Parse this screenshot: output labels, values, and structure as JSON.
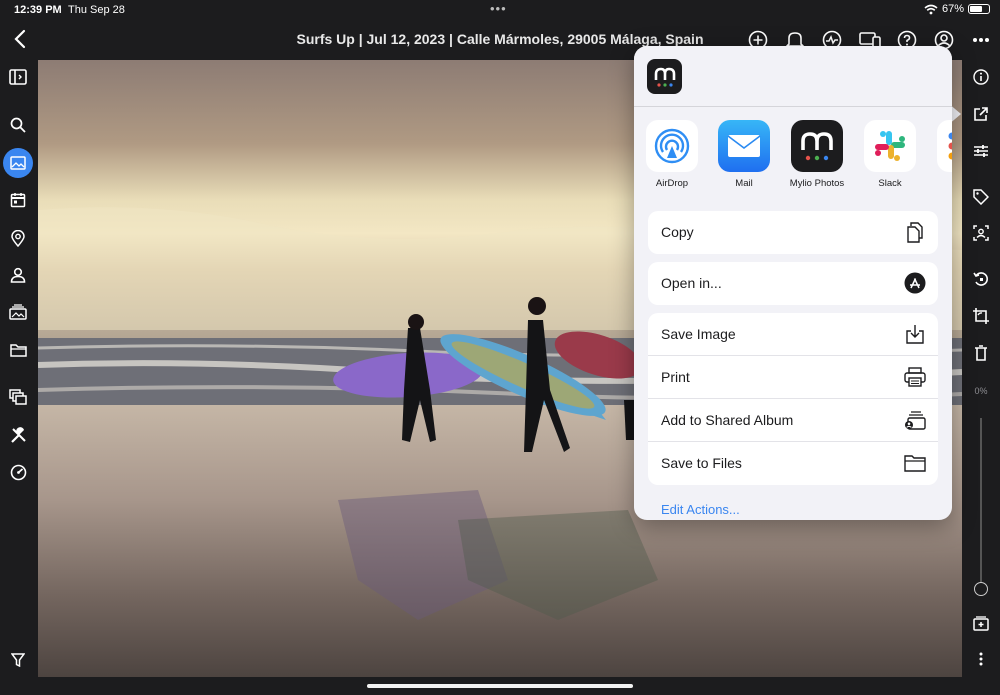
{
  "status_bar": {
    "time": "12:39 PM",
    "date": "Thu Sep 28",
    "center_dots": "•••",
    "battery_percent": "67%",
    "battery_level": 0.67
  },
  "header": {
    "title": "Surfs Up | Jul 12, 2023 | Calle Mármoles, 29005 Málaga, Spain",
    "icons": [
      "back-icon",
      "add-icon",
      "bell-icon",
      "activity-icon",
      "devices-icon",
      "help-icon",
      "account-icon",
      "more-icon"
    ]
  },
  "left_sidebar": {
    "items": [
      "sidebar-panel-icon",
      "search-icon",
      "photos-icon",
      "calendar-icon",
      "map-pin-icon",
      "person-icon",
      "albums-icon",
      "folder-icon",
      "stack-icon",
      "tools-icon",
      "dashboard-icon",
      "filter-icon"
    ],
    "active": "photos-icon"
  },
  "right_sidebar": {
    "items": [
      "info-icon",
      "share-icon",
      "adjust-icon",
      "tag-icon",
      "face-icon",
      "rotate-icon",
      "crop-icon",
      "trash-icon",
      "add-to-album-icon",
      "more-vertical-icon"
    ],
    "zoom_label": "0%",
    "zoom_level": 0
  },
  "share_sheet": {
    "apps": [
      {
        "label": "AirDrop",
        "icon": "airdrop-icon"
      },
      {
        "label": "Mail",
        "icon": "mail-icon"
      },
      {
        "label": "Mylio Photos",
        "icon": "mylio-icon"
      },
      {
        "label": "Slack",
        "icon": "slack-icon"
      },
      {
        "label": "Re",
        "icon": "reminders-icon"
      }
    ],
    "group1": [
      {
        "label": "Copy",
        "icon": "copy-icon"
      }
    ],
    "group2": [
      {
        "label": "Open in...",
        "icon": "app-store-icon"
      }
    ],
    "group3": [
      {
        "label": "Save Image",
        "icon": "save-image-icon"
      },
      {
        "label": "Print",
        "icon": "print-icon"
      },
      {
        "label": "Add to Shared Album",
        "icon": "shared-album-icon"
      },
      {
        "label": "Save to Files",
        "icon": "folder-icon"
      }
    ],
    "edit_actions": "Edit Actions..."
  },
  "colors": {
    "accent": "#3a86f0",
    "chrome": "#1c1c1e",
    "sheet_bg": "#f2f2f7"
  }
}
